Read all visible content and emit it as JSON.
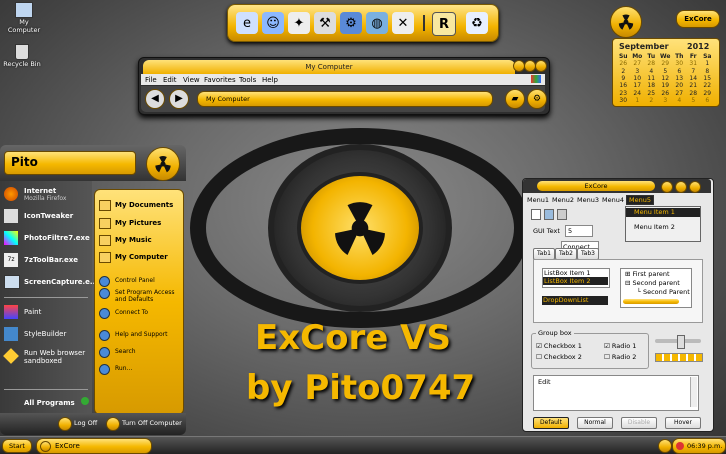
{
  "desktop": {
    "icons": [
      {
        "label": "My Computer"
      },
      {
        "label": "Recycle Bin"
      }
    ]
  },
  "wallpaper": {
    "title_line1": "ExCore VS",
    "title_line2": "by Pito0747"
  },
  "dock": {
    "icons": [
      "ie-icon",
      "messenger-icon",
      "satellite-icon",
      "tools-icon",
      "network-icon",
      "globe-icon",
      "settings-icon",
      "separator",
      "r-icon",
      "recycle-icon"
    ]
  },
  "corner": {
    "excore_label": "ExCore"
  },
  "calendar": {
    "month": "September",
    "year": "2012",
    "headers": [
      "Su",
      "Mo",
      "Tu",
      "We",
      "Th",
      "Fr",
      "Sa"
    ],
    "rows": [
      [
        "26",
        "27",
        "28",
        "29",
        "30",
        "31",
        "1"
      ],
      [
        "2",
        "3",
        "4",
        "5",
        "6",
        "7",
        "8"
      ],
      [
        "9",
        "10",
        "11",
        "12",
        "13",
        "14",
        "15"
      ],
      [
        "16",
        "17",
        "18",
        "19",
        "20",
        "21",
        "22"
      ],
      [
        "23",
        "24",
        "25",
        "26",
        "27",
        "28",
        "29"
      ],
      [
        "30",
        "1",
        "2",
        "3",
        "4",
        "5",
        "6"
      ]
    ]
  },
  "mycomputer": {
    "title": "My Computer",
    "menu": [
      "File",
      "Edit",
      "View",
      "Favorites",
      "Tools",
      "Help"
    ],
    "address": "My Computer"
  },
  "startmenu": {
    "user": "Pito",
    "left_pinned": [
      {
        "title": "Internet",
        "sub": "Mozilla Firefox"
      },
      {
        "title": "IconTweaker",
        "sub": ""
      },
      {
        "title": "PhotoFiltre7.exe",
        "sub": ""
      },
      {
        "title": "7zToolBar.exe",
        "sub": ""
      },
      {
        "title": "ScreenCapture.e...",
        "sub": ""
      }
    ],
    "left_recent": [
      "Paint",
      "StyleBuilder",
      "Run Web browser sandboxed"
    ],
    "all_programs": "All Programs",
    "right_items": [
      "My Documents",
      "My Pictures",
      "My Music",
      "My Computer"
    ],
    "right_items2": [
      "Control Panel",
      "Set Program Access and Defaults",
      "Connect To",
      "Help and Support",
      "Search",
      "Run..."
    ],
    "logoff": "Log Off",
    "turnoff": "Turn Off Computer"
  },
  "excore": {
    "title": "ExCore",
    "menus": [
      "Menu1",
      "Menu2",
      "Menu3",
      "Menu4",
      "Menu5"
    ],
    "menu5_items": [
      "Menu Item 1",
      "Menu Item 2"
    ],
    "gui_text_label": "GUI Text",
    "spin_value": "5",
    "dropdown_value": "Connect To",
    "tabs": [
      "Tab1",
      "Tab2",
      "Tab3"
    ],
    "list_items": [
      "ListBox Item 1",
      "ListBox Item 2"
    ],
    "dropdown_list": "DropDownList",
    "tree": [
      "First parent",
      "Second parent",
      "Second Parent"
    ],
    "groupbox": "Group box",
    "checks": [
      "Checkbox 1",
      "Checkbox 2"
    ],
    "radios": [
      "Radio 1",
      "Radio 2"
    ],
    "edit_text": "Edit",
    "buttons": [
      "Default",
      "Normal",
      "Disable",
      "Hover"
    ]
  },
  "taskbar": {
    "start": "Start",
    "task": "ExCore",
    "time": "06:39 p.m."
  },
  "colors": {
    "gold": "#f5b800",
    "dark": "#1e1e1e"
  }
}
